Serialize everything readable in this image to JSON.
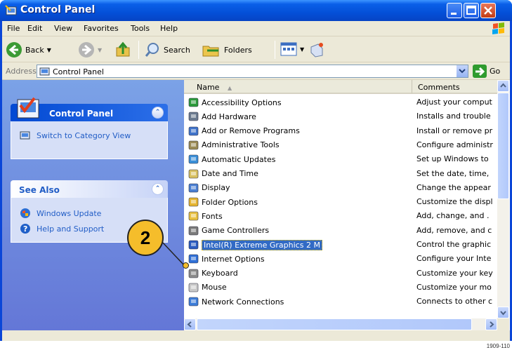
{
  "window": {
    "title": "Control Panel"
  },
  "menu": [
    "File",
    "Edit",
    "View",
    "Favorites",
    "Tools",
    "Help"
  ],
  "toolbar": {
    "back": "Back",
    "search": "Search",
    "folders": "Folders"
  },
  "address": {
    "label": "Address",
    "value": "Control Panel",
    "go": "Go"
  },
  "left": {
    "panel_title": "Control Panel",
    "switch_view": "Switch to Category View",
    "see_also": "See Also",
    "links": [
      "Windows Update",
      "Help and Support"
    ]
  },
  "columns": {
    "name": "Name",
    "comments": "Comments"
  },
  "items": [
    {
      "name": "Accessibility Options",
      "comment": "Adjust your comput",
      "icon": "accessibility-icon",
      "color": "#2b9a3b"
    },
    {
      "name": "Add Hardware",
      "comment": "Installs and trouble",
      "icon": "add-hardware-icon",
      "color": "#6b7a8f"
    },
    {
      "name": "Add or Remove Programs",
      "comment": "Install or remove pr",
      "icon": "add-remove-programs-icon",
      "color": "#3f73c9"
    },
    {
      "name": "Administrative Tools",
      "comment": "Configure administr",
      "icon": "admin-tools-icon",
      "color": "#9a8a55"
    },
    {
      "name": "Automatic Updates",
      "comment": "Set up Windows to",
      "icon": "automatic-updates-icon",
      "color": "#3a8fd8"
    },
    {
      "name": "Date and Time",
      "comment": "Set the date, time,",
      "icon": "date-time-icon",
      "color": "#d8c060"
    },
    {
      "name": "Display",
      "comment": "Change the appear",
      "icon": "display-icon",
      "color": "#4a7fd2"
    },
    {
      "name": "Folder Options",
      "comment": "Customize the displ",
      "icon": "folder-options-icon",
      "color": "#e5b430"
    },
    {
      "name": "Fonts",
      "comment": "Add, change, and .",
      "icon": "fonts-icon",
      "color": "#e8c040"
    },
    {
      "name": "Game Controllers",
      "comment": "Add, remove, and c",
      "icon": "game-controllers-icon",
      "color": "#7a7a7a"
    },
    {
      "name": "Intel(R) Extreme Graphics 2 M",
      "comment": "Control the graphic",
      "icon": "intel-graphics-icon",
      "color": "#2a5bc0",
      "selected": true
    },
    {
      "name": "Internet Options",
      "comment": "Configure your Inte",
      "icon": "internet-options-icon",
      "color": "#2f6fd6"
    },
    {
      "name": "Keyboard",
      "comment": "Customize your key",
      "icon": "keyboard-icon",
      "color": "#8b8b8b"
    },
    {
      "name": "Mouse",
      "comment": "Customize your mo",
      "icon": "mouse-icon",
      "color": "#c8c8c8"
    },
    {
      "name": "Network Connections",
      "comment": "Connects to other c",
      "icon": "network-connections-icon",
      "color": "#3d7dd8"
    }
  ],
  "callout": {
    "number": "2"
  },
  "figure_id": "1909-110"
}
